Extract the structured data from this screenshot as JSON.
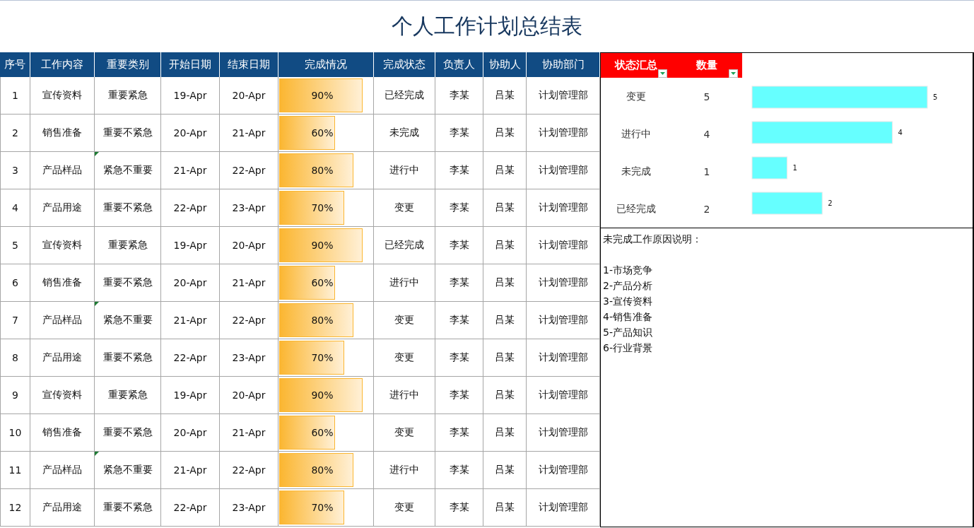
{
  "title": "个人工作计划总结表",
  "table": {
    "columns": [
      "序号",
      "工作内容",
      "重要类别",
      "开始日期",
      "结束日期",
      "完成情况",
      "完成状态",
      "负责人",
      "协助人",
      "协助部门"
    ],
    "rows": [
      {
        "no": "1",
        "task": "宣传资料",
        "category": "重要紧急",
        "note_mark": false,
        "start": "19-Apr",
        "end": "20-Apr",
        "level": 0.9,
        "pct": "90%",
        "status": "已经完成",
        "owner": "李某",
        "helper": "吕某",
        "dept": "计划管理部"
      },
      {
        "no": "2",
        "task": "销售准备",
        "category": "重要不紧急",
        "note_mark": false,
        "start": "20-Apr",
        "end": "21-Apr",
        "level": 0.6,
        "pct": "60%",
        "status": "未完成",
        "owner": "李某",
        "helper": "吕某",
        "dept": "计划管理部"
      },
      {
        "no": "3",
        "task": "产品样品",
        "category": "紧急不重要",
        "note_mark": true,
        "start": "21-Apr",
        "end": "22-Apr",
        "level": 0.8,
        "pct": "80%",
        "status": "进行中",
        "owner": "李某",
        "helper": "吕某",
        "dept": "计划管理部"
      },
      {
        "no": "4",
        "task": "产品用途",
        "category": "重要不紧急",
        "note_mark": false,
        "start": "22-Apr",
        "end": "23-Apr",
        "level": 0.7,
        "pct": "70%",
        "status": "变更",
        "owner": "李某",
        "helper": "吕某",
        "dept": "计划管理部"
      },
      {
        "no": "5",
        "task": "宣传资料",
        "category": "重要紧急",
        "note_mark": false,
        "start": "19-Apr",
        "end": "20-Apr",
        "level": 0.9,
        "pct": "90%",
        "status": "已经完成",
        "owner": "李某",
        "helper": "吕某",
        "dept": "计划管理部"
      },
      {
        "no": "6",
        "task": "销售准备",
        "category": "重要不紧急",
        "note_mark": false,
        "start": "20-Apr",
        "end": "21-Apr",
        "level": 0.6,
        "pct": "60%",
        "status": "进行中",
        "owner": "李某",
        "helper": "吕某",
        "dept": "计划管理部"
      },
      {
        "no": "7",
        "task": "产品样品",
        "category": "紧急不重要",
        "note_mark": true,
        "start": "21-Apr",
        "end": "22-Apr",
        "level": 0.8,
        "pct": "80%",
        "status": "变更",
        "owner": "李某",
        "helper": "吕某",
        "dept": "计划管理部"
      },
      {
        "no": "8",
        "task": "产品用途",
        "category": "重要不紧急",
        "note_mark": false,
        "start": "22-Apr",
        "end": "23-Apr",
        "level": 0.7,
        "pct": "70%",
        "status": "变更",
        "owner": "李某",
        "helper": "吕某",
        "dept": "计划管理部"
      },
      {
        "no": "9",
        "task": "宣传资料",
        "category": "重要紧急",
        "note_mark": false,
        "start": "19-Apr",
        "end": "20-Apr",
        "level": 0.9,
        "pct": "90%",
        "status": "进行中",
        "owner": "李某",
        "helper": "吕某",
        "dept": "计划管理部"
      },
      {
        "no": "10",
        "task": "销售准备",
        "category": "重要不紧急",
        "note_mark": false,
        "start": "20-Apr",
        "end": "21-Apr",
        "level": 0.6,
        "pct": "60%",
        "status": "变更",
        "owner": "李某",
        "helper": "吕某",
        "dept": "计划管理部"
      },
      {
        "no": "11",
        "task": "产品样品",
        "category": "紧急不重要",
        "note_mark": true,
        "start": "21-Apr",
        "end": "22-Apr",
        "level": 0.8,
        "pct": "80%",
        "status": "进行中",
        "owner": "李某",
        "helper": "吕某",
        "dept": "计划管理部"
      },
      {
        "no": "12",
        "task": "产品用途",
        "category": "重要不紧急",
        "note_mark": false,
        "start": "22-Apr",
        "end": "23-Apr",
        "level": 0.7,
        "pct": "70%",
        "status": "变更",
        "owner": "李某",
        "helper": "吕某",
        "dept": "计划管理部"
      }
    ]
  },
  "summary": {
    "columns": [
      "状态汇总",
      "数量"
    ],
    "rows": [
      {
        "status": "变更",
        "count": "5"
      },
      {
        "status": "进行中",
        "count": "4"
      },
      {
        "status": "未完成",
        "count": "1"
      },
      {
        "status": "已经完成",
        "count": "2"
      }
    ],
    "chart_data": {
      "type": "bar",
      "orientation": "horizontal",
      "series": [
        {
          "color": "#66ffff",
          "values": [
            5,
            4,
            1,
            2
          ]
        }
      ],
      "data_labels": true,
      "value_labels": [
        "5",
        "4",
        "1",
        "2"
      ]
    }
  },
  "notes": {
    "heading": "未完成工作原因说明：",
    "items": [
      "1-市场竞争",
      "2-产品分析",
      "3-宣传资料",
      "4-销售准备",
      "5-产品知识",
      "6-行业背景"
    ]
  }
}
